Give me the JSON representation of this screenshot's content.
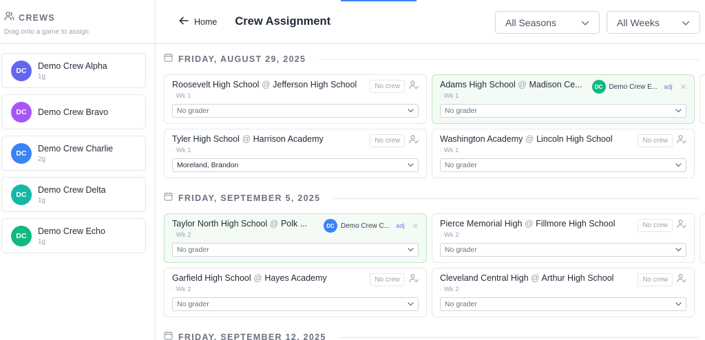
{
  "sidebar": {
    "title": "CREWS",
    "hint": "Drag onto a game to assign",
    "crews": [
      {
        "initials": "DC",
        "name": "Demo Crew Alpha",
        "meta": "1g",
        "color": "#6366f1"
      },
      {
        "initials": "DC",
        "name": "Demo Crew Bravo",
        "meta": "",
        "color": "#a855f7"
      },
      {
        "initials": "DC",
        "name": "Demo Crew Charlie",
        "meta": "2g",
        "color": "#3b82f6"
      },
      {
        "initials": "DC",
        "name": "Demo Crew Delta",
        "meta": "1g",
        "color": "#14b8a6"
      },
      {
        "initials": "DC",
        "name": "Demo Crew Echo",
        "meta": "1g",
        "color": "#10b981"
      }
    ]
  },
  "header": {
    "back_label": "Home",
    "title": "Crew Assignment",
    "seasons_select": "All Seasons",
    "weeks_select": "All Weeks"
  },
  "sections": [
    {
      "date": "FRIDAY, AUGUST 29, 2025",
      "games": [
        {
          "home": "Roosevelt High School",
          "away": "Jefferson High School",
          "week": "· Wk 1",
          "crew": "No crew",
          "grader": "No grader"
        },
        {
          "home": "Adams High School",
          "away": "Madison Ce...",
          "week": "· Wk 1",
          "crew_name": "Demo Crew E...",
          "crew_initials": "DC",
          "crew_color": "#10b981",
          "adj": "adj",
          "grader": "No grader"
        },
        {
          "home": "Tyler High School",
          "away": "Harrison Academy",
          "week": "· Wk 1",
          "crew": "No crew",
          "grader": "Moreland, Brandon"
        },
        {
          "home": "Washington Academy",
          "away": "Lincoln High School",
          "week": "· Wk 1",
          "crew": "No crew",
          "grader": "No grader"
        }
      ]
    },
    {
      "date": "FRIDAY, SEPTEMBER 5, 2025",
      "games": [
        {
          "home": "Taylor North High School",
          "away": "Polk ...",
          "week": "· Wk 2",
          "crew_name": "Demo Crew C...",
          "crew_initials": "DC",
          "crew_color": "#3b82f6",
          "adj": "adj",
          "grader": "No grader"
        },
        {
          "home": "Pierce Memorial High",
          "away": "Fillmore High School",
          "week": "· Wk 2",
          "crew": "No crew",
          "grader": "No grader"
        },
        {
          "home": "Garfield High School",
          "away": "Hayes Academy",
          "week": "· Wk 2",
          "crew": "No crew",
          "grader": "No grader"
        },
        {
          "home": "Cleveland Central High",
          "away": "Arthur High School",
          "week": "· Wk 2",
          "crew": "No crew",
          "grader": "No grader"
        }
      ]
    },
    {
      "date": "FRIDAY, SEPTEMBER 12, 2025",
      "games": []
    }
  ],
  "at_symbol": "@",
  "icons": {
    "crews": "users-icon",
    "back": "arrow-left-icon",
    "calendar": "calendar-icon",
    "chevron": "chevron-down-icon",
    "assign": "user-check-icon",
    "remove": "close-icon"
  }
}
